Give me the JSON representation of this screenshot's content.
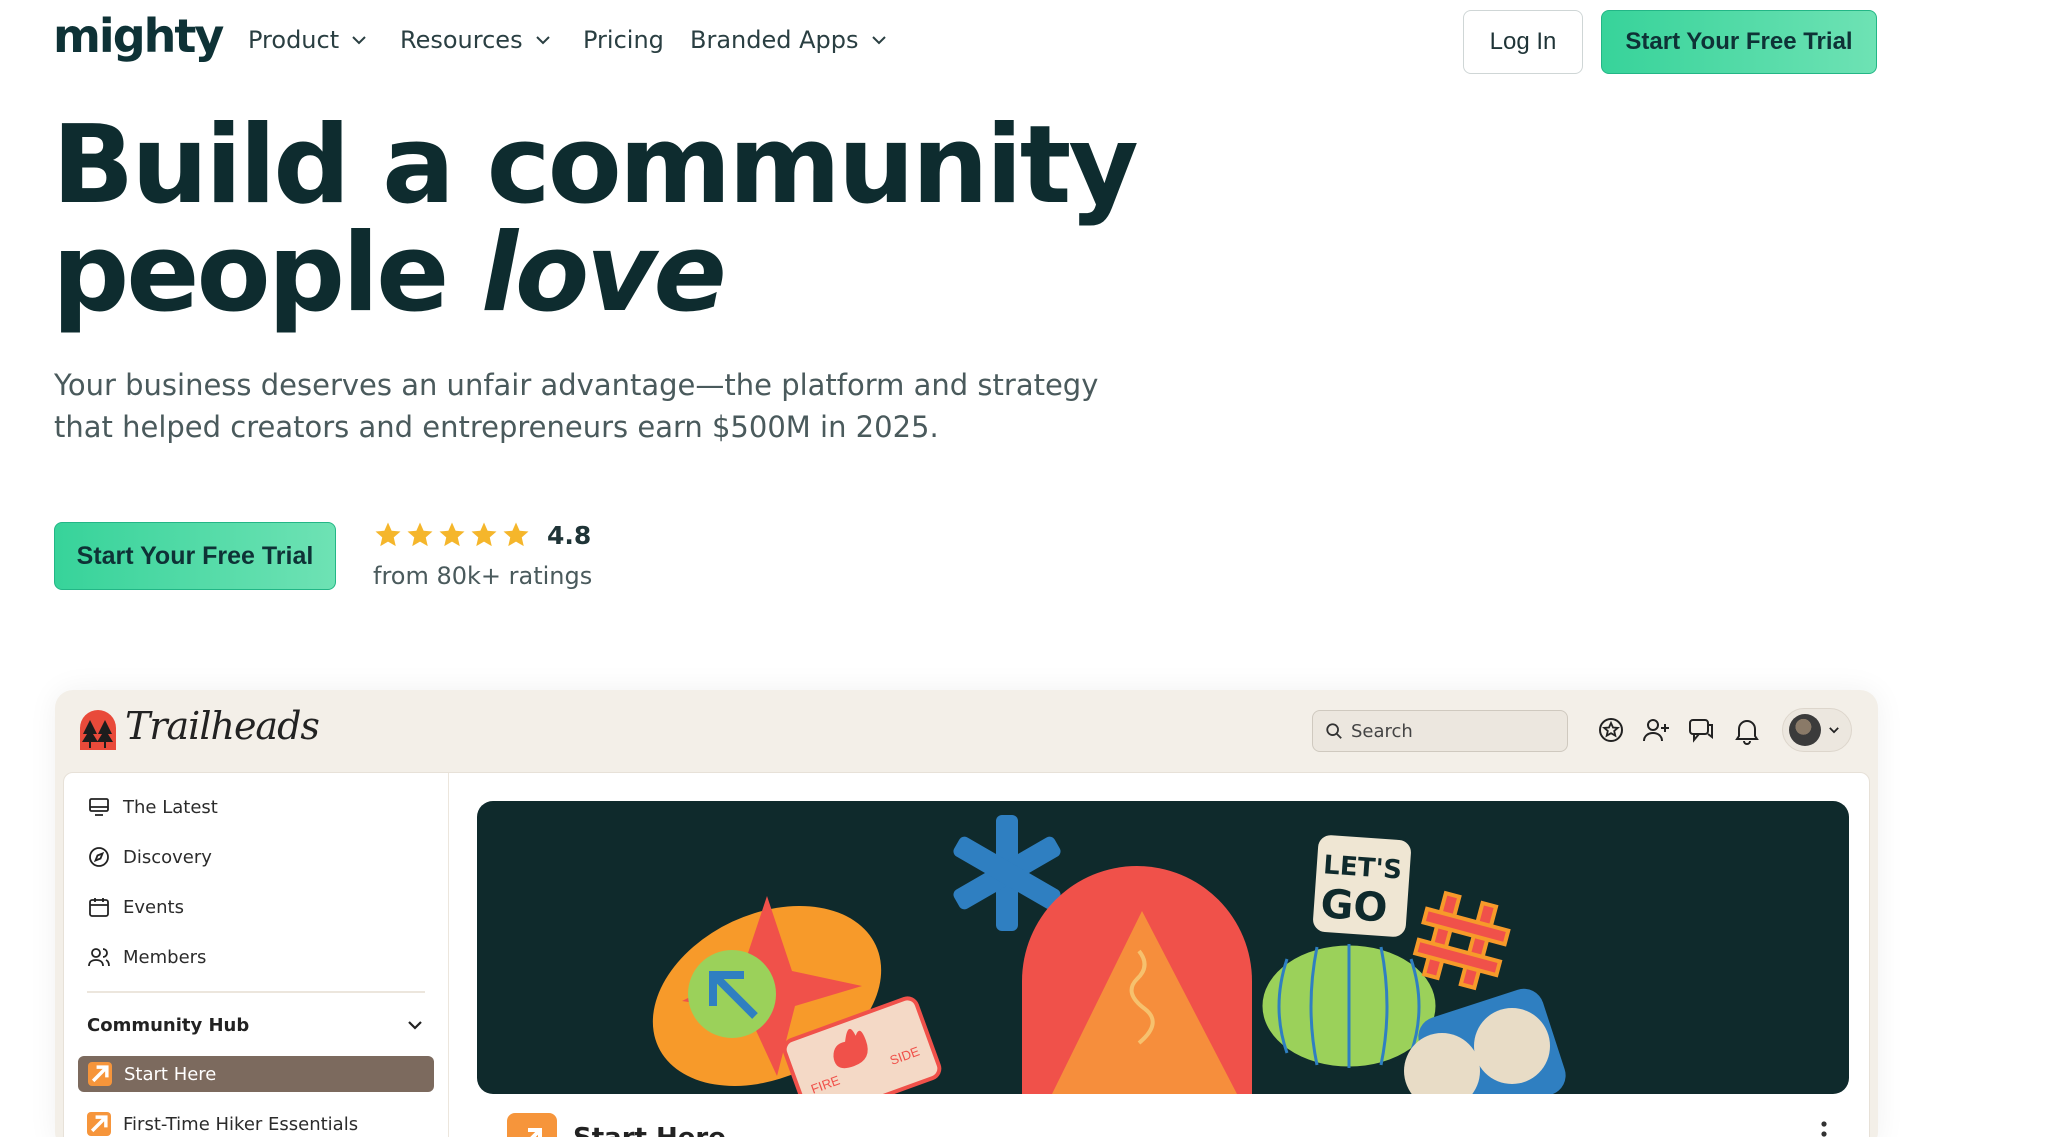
{
  "nav": {
    "logo": "mighty",
    "items": [
      {
        "label": "Product",
        "has_dropdown": true
      },
      {
        "label": "Resources",
        "has_dropdown": true
      },
      {
        "label": "Pricing",
        "has_dropdown": false
      },
      {
        "label": "Branded Apps",
        "has_dropdown": true
      }
    ],
    "login_label": "Log In",
    "trial_label": "Start Your Free Trial"
  },
  "hero": {
    "title_line1": "Build a community",
    "title_line2_plain": "people ",
    "title_line2_em": "love",
    "subtitle": "Your business deserves an unfair advantage—the platform and strategy that helped creators and entrepreneurs earn $500M in 2025.",
    "cta_label": "Start Your Free Trial",
    "rating": {
      "stars": 5,
      "value": "4.8",
      "note": "from 80k+ ratings",
      "star_color": "#f5b62b"
    }
  },
  "app_preview": {
    "brand": "Trailheads",
    "search_placeholder": "Search",
    "header_icons": [
      "badge-star-icon",
      "add-user-icon",
      "chat-icon",
      "bell-icon"
    ],
    "sidebar": {
      "items": [
        {
          "label": "The Latest",
          "icon": "monitor-icon"
        },
        {
          "label": "Discovery",
          "icon": "compass-icon"
        },
        {
          "label": "Events",
          "icon": "calendar-icon"
        },
        {
          "label": "Members",
          "icon": "members-icon"
        }
      ],
      "group_title": "Community Hub",
      "group_items": [
        {
          "label": "Start Here",
          "active": true
        },
        {
          "label": "First-Time Hiker Essentials",
          "active": false
        }
      ]
    },
    "banner_text": {
      "lets_go_top": "LET'S",
      "lets_go_bottom": "GO",
      "fire_left": "FIRE",
      "fire_right": "SIDE"
    },
    "post_title": "Start Here"
  },
  "colors": {
    "brand_green": "#37d39a",
    "dark_teal": "#0e2c2f",
    "active_sidebar": "#7c6a5e",
    "accent_orange": "#f6953b"
  }
}
